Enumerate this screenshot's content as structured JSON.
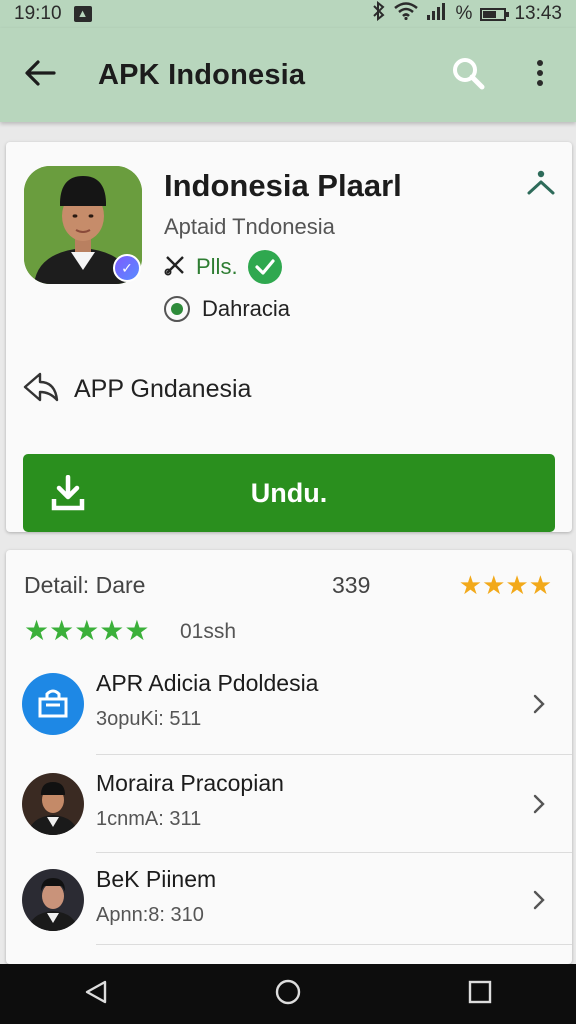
{
  "status_bar": {
    "time_left": "19:10",
    "notification_icon": "notification-box-icon",
    "percent_symbol": "%",
    "time_right": "13:43"
  },
  "app_bar": {
    "title": "APK Indonesia",
    "back_icon": "arrow-back-icon",
    "search_icon": "search-icon",
    "more_icon": "more-vert-icon"
  },
  "app_card": {
    "name": "Indonesia Plaarl",
    "developer": "Aptaid Tndonesia",
    "badge_label": "Plls.",
    "radio_label": "Dahracia",
    "share_label": "APP Gndanesia",
    "download_label": "Undu.",
    "colors": {
      "accent": "#2a8f1e",
      "check": "#2fa84f"
    }
  },
  "detail_card": {
    "title": "Detail: Dare",
    "count": "339",
    "orange_stars": "★★★★",
    "green_stars": "★★★★★",
    "green_count": "01ssh",
    "items": [
      {
        "title": "APR Adicia Pdoldesia",
        "subtitle": "3opuKi: 511",
        "avatar": "store-bag-icon"
      },
      {
        "title": "Moraira Pracopian",
        "subtitle": "1cnmA: 311",
        "avatar": "person-avatar"
      },
      {
        "title": "BeK Piinem",
        "subtitle": "Apnn:8: 310",
        "avatar": "person-avatar"
      }
    ]
  },
  "nav_bar": {
    "back": "nav-back-icon",
    "home": "nav-home-icon",
    "recents": "nav-recents-icon"
  }
}
